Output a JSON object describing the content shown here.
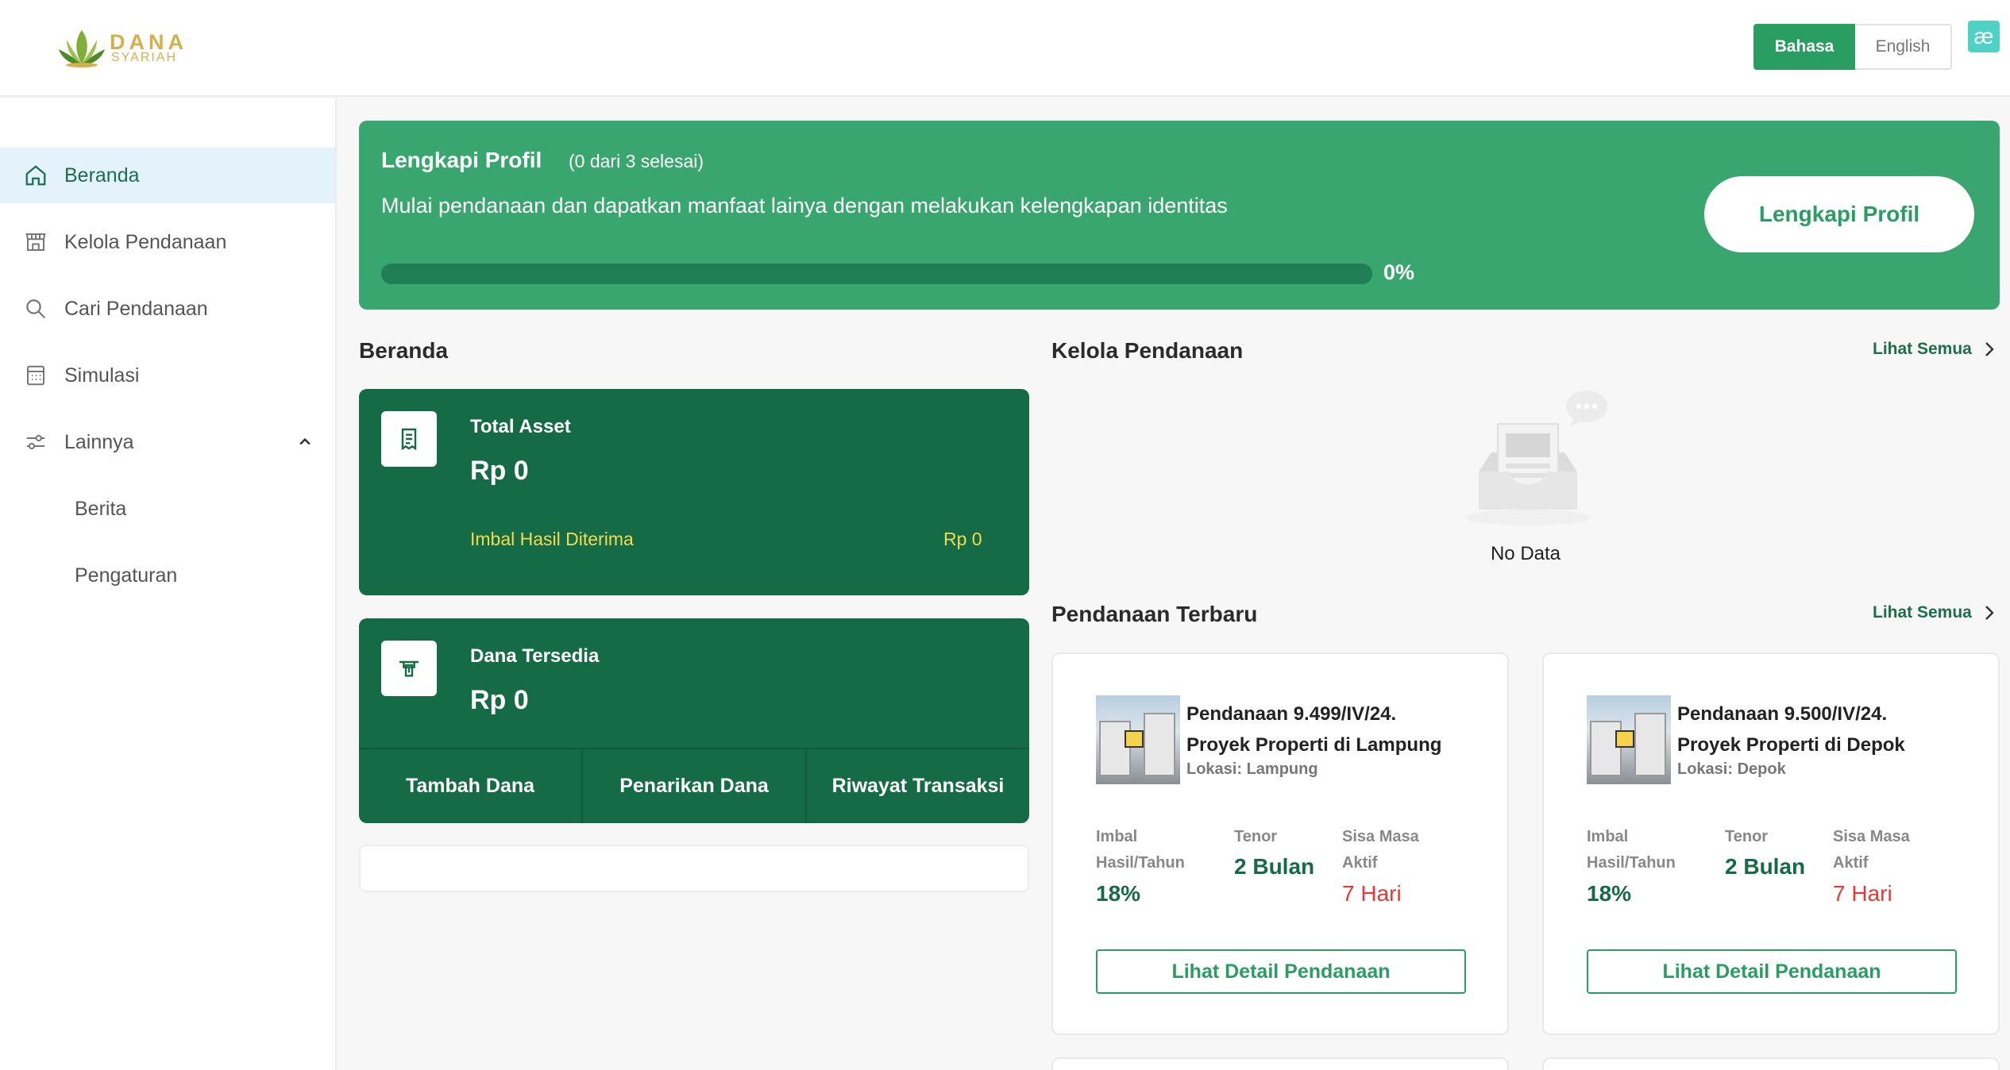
{
  "header": {
    "logo_line1": "DANA",
    "logo_line2": "SYARIAH",
    "lang_active": "Bahasa",
    "lang_inactive": "English",
    "badge": "æ"
  },
  "sidebar": {
    "items": [
      {
        "label": "Beranda",
        "icon": "home-icon"
      },
      {
        "label": "Kelola Pendanaan",
        "icon": "store-icon"
      },
      {
        "label": "Cari Pendanaan",
        "icon": "search-icon"
      },
      {
        "label": "Simulasi",
        "icon": "calculator-icon"
      },
      {
        "label": "Lainnya",
        "icon": "sliders-icon"
      }
    ],
    "sub_items": [
      {
        "label": "Berita"
      },
      {
        "label": "Pengaturan"
      }
    ]
  },
  "banner": {
    "title": "Lengkapi Profil",
    "count": "(0 dari 3 selesai)",
    "description": "Mulai pendanaan dan dapatkan manfaat lainya dengan melakukan kelengkapan identitas",
    "progress_percent": 0,
    "progress_text": "0%",
    "button": "Lengkapi Profil"
  },
  "beranda": {
    "title": "Beranda",
    "total_asset_label": "Total Asset",
    "total_asset_value": "Rp 0",
    "imbal_label": "Imbal Hasil Diterima",
    "imbal_value": "Rp 0",
    "dana_label": "Dana Tersedia",
    "dana_value": "Rp 0",
    "actions": [
      "Tambah Dana",
      "Penarikan Dana",
      "Riwayat Transaksi"
    ]
  },
  "kelola": {
    "title": "Kelola Pendanaan",
    "see_all": "Lihat Semua",
    "empty_text": "No Data"
  },
  "terbaru": {
    "title": "Pendanaan Terbaru",
    "see_all": "Lihat Semua",
    "cards": [
      {
        "title_line1": "Pendanaan 9.499/IV/24.",
        "title_line2": "Proyek Properti di Lampung",
        "location": "Lokasi: Lampung",
        "imbal_label_1": "Imbal",
        "imbal_label_2": "Hasil/Tahun",
        "imbal_value": "18%",
        "tenor_label": "Tenor",
        "tenor_value": "2 Bulan",
        "sisa_label_1": "Sisa Masa",
        "sisa_label_2": "Aktif",
        "sisa_value": "7 Hari",
        "button": "Lihat Detail Pendanaan"
      },
      {
        "title_line1": "Pendanaan 9.500/IV/24.",
        "title_line2": "Proyek Properti di Depok",
        "location": "Lokasi: Depok",
        "imbal_label_1": "Imbal",
        "imbal_label_2": "Hasil/Tahun",
        "imbal_value": "18%",
        "tenor_label": "Tenor",
        "tenor_value": "2 Bulan",
        "sisa_label_1": "Sisa Masa",
        "sisa_label_2": "Aktif",
        "sisa_value": "7 Hari",
        "button": "Lihat Detail Pendanaan"
      }
    ]
  },
  "colors": {
    "primary": "#2a9d63",
    "dark_green": "#166b47",
    "banner": "#38a66e",
    "accent_yellow": "#f3dc4c",
    "danger": "#e53935"
  }
}
